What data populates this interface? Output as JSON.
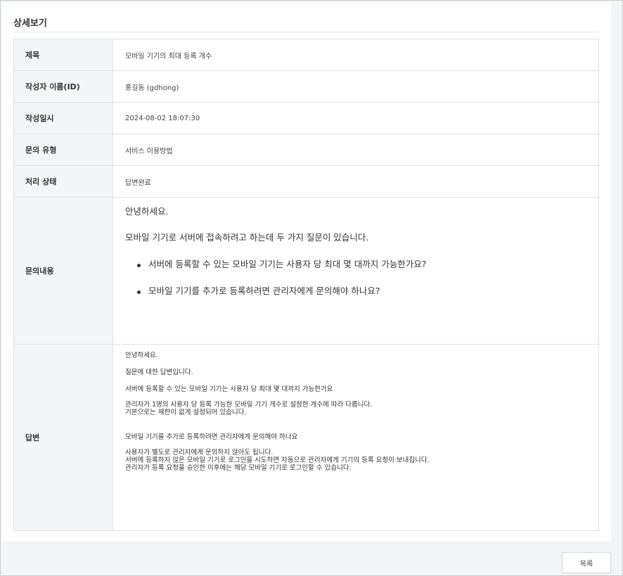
{
  "panel": {
    "title": "상세보기"
  },
  "detail": {
    "rows": [
      {
        "label": "제목",
        "value": "모바일 기기의 최대 등록 개수"
      },
      {
        "label": "작성자 이름(ID)",
        "value": "홍길동 (gdhong)"
      },
      {
        "label": "작성일시",
        "value": "2024-08-02 18:07:30"
      },
      {
        "label": "문의 유형",
        "value": "서비스 이용방법"
      },
      {
        "label": "처리 상태",
        "value": "답변완료"
      }
    ],
    "inquiry": {
      "label": "문의내용",
      "greeting": "안녕하세요.",
      "intro": "모바일 기기로 서버에 접속하려고 하는데 두 가지 질문이 있습니다.",
      "questions": [
        "서버에 등록할 수 있는 모바일 기기는 사용자 당 최대 몇 대까지 가능한가요?",
        "모바일 기기를 추가로 등록하려면 관리자에게 문의해야 하나요?"
      ]
    },
    "answer": {
      "label": "답변",
      "lines": {
        "greeting": "안녕하세요.",
        "intro": "질문에 대한 답변입니다.",
        "q1": "서버에 등록할 수 있는 모바일 기기는 사용자 당 최대 몇 대까지 가능한가요",
        "a1_1": "관리자가 1명의 사용자 당 등록 가능한 모바일 기기 개수로 설정한 개수에 따라 다릅니다.",
        "a1_2": "기본으로는 제한이 없게 설정되어 있습니다.",
        "q2": "모바일 기기를 추가로 등록하려면 관리자에게 문의해야 하나요",
        "a2_1": "사용자가 별도로 관리자에게 문의하지 않아도 됩니다.",
        "a2_2": "서버에 등록하지 않은 모바일 기기로 로그인을 시도하면 자동으로 관리자에게 기기의 등록 요청이 보내집니다.",
        "a2_3": "관리자가 등록 요청을 승인한 이후에는 해당 모바일 기기로 로그인할 수 있습니다."
      }
    }
  },
  "footer": {
    "list_button": "목록"
  }
}
